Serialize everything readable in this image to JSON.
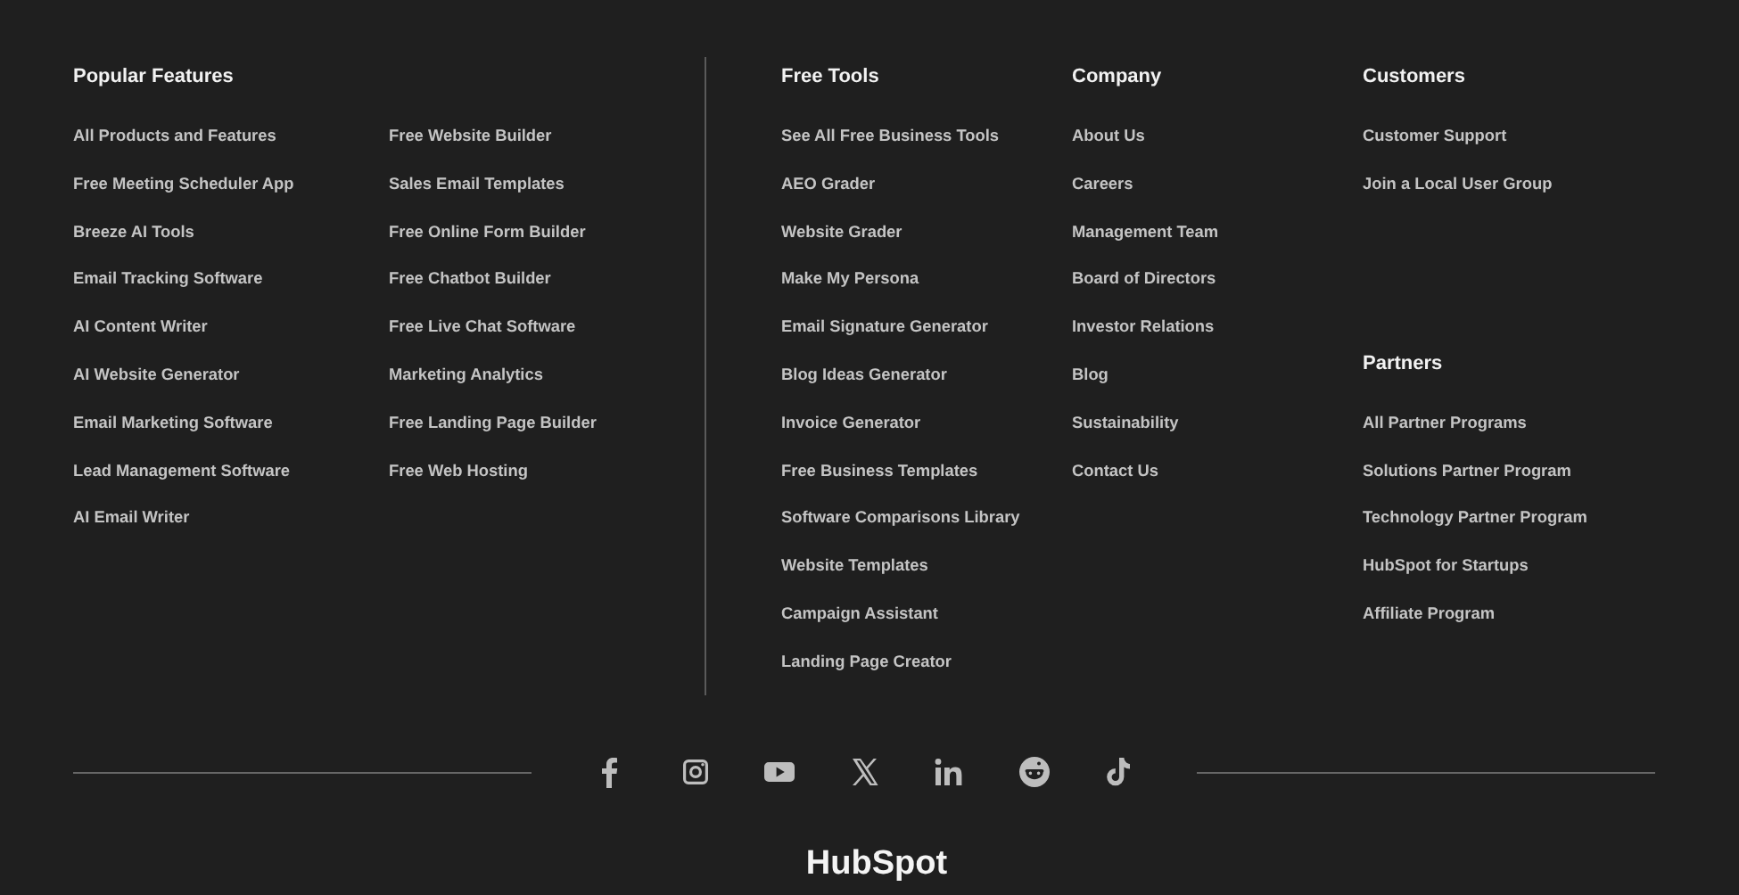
{
  "popular_features": {
    "heading": "Popular Features",
    "columns": [
      [
        "All Products and Features",
        "Free Meeting Scheduler App",
        "Breeze AI Tools",
        "Email Tracking Software",
        "AI Content Writer",
        "AI Website Generator",
        "Email Marketing Software",
        "Lead Management Software",
        "AI Email Writer"
      ],
      [
        "Free Website Builder",
        "Sales Email Templates",
        "Free Online Form Builder",
        "Free Chatbot Builder",
        "Free Live Chat Software",
        "Marketing Analytics",
        "Free Landing Page Builder",
        "Free Web Hosting"
      ]
    ]
  },
  "columns": [
    [
      {
        "heading": "Free Tools",
        "links": [
          "See All Free Business Tools",
          "AEO Grader",
          "Website Grader",
          "Make My Persona",
          "Email Signature Generator",
          "Blog Ideas Generator",
          "Invoice Generator",
          "Free Business Templates",
          "Software Comparisons Library",
          "Website Templates",
          "Campaign Assistant",
          "Landing Page Creator"
        ]
      }
    ],
    [
      {
        "heading": "Company",
        "links": [
          "About Us",
          "Careers",
          "Management Team",
          "Board of Directors",
          "Investor Relations",
          "Blog",
          "Sustainability",
          "Contact Us"
        ]
      }
    ],
    [
      {
        "heading": "Customers",
        "links": [
          "Customer Support",
          "Join a Local User Group"
        ]
      },
      {
        "heading": "Partners",
        "links": [
          "All Partner Programs",
          "Solutions Partner Program",
          "Technology Partner Program",
          "HubSpot for Startups",
          "Affiliate Program"
        ]
      }
    ]
  ],
  "logo": "HubSpot"
}
